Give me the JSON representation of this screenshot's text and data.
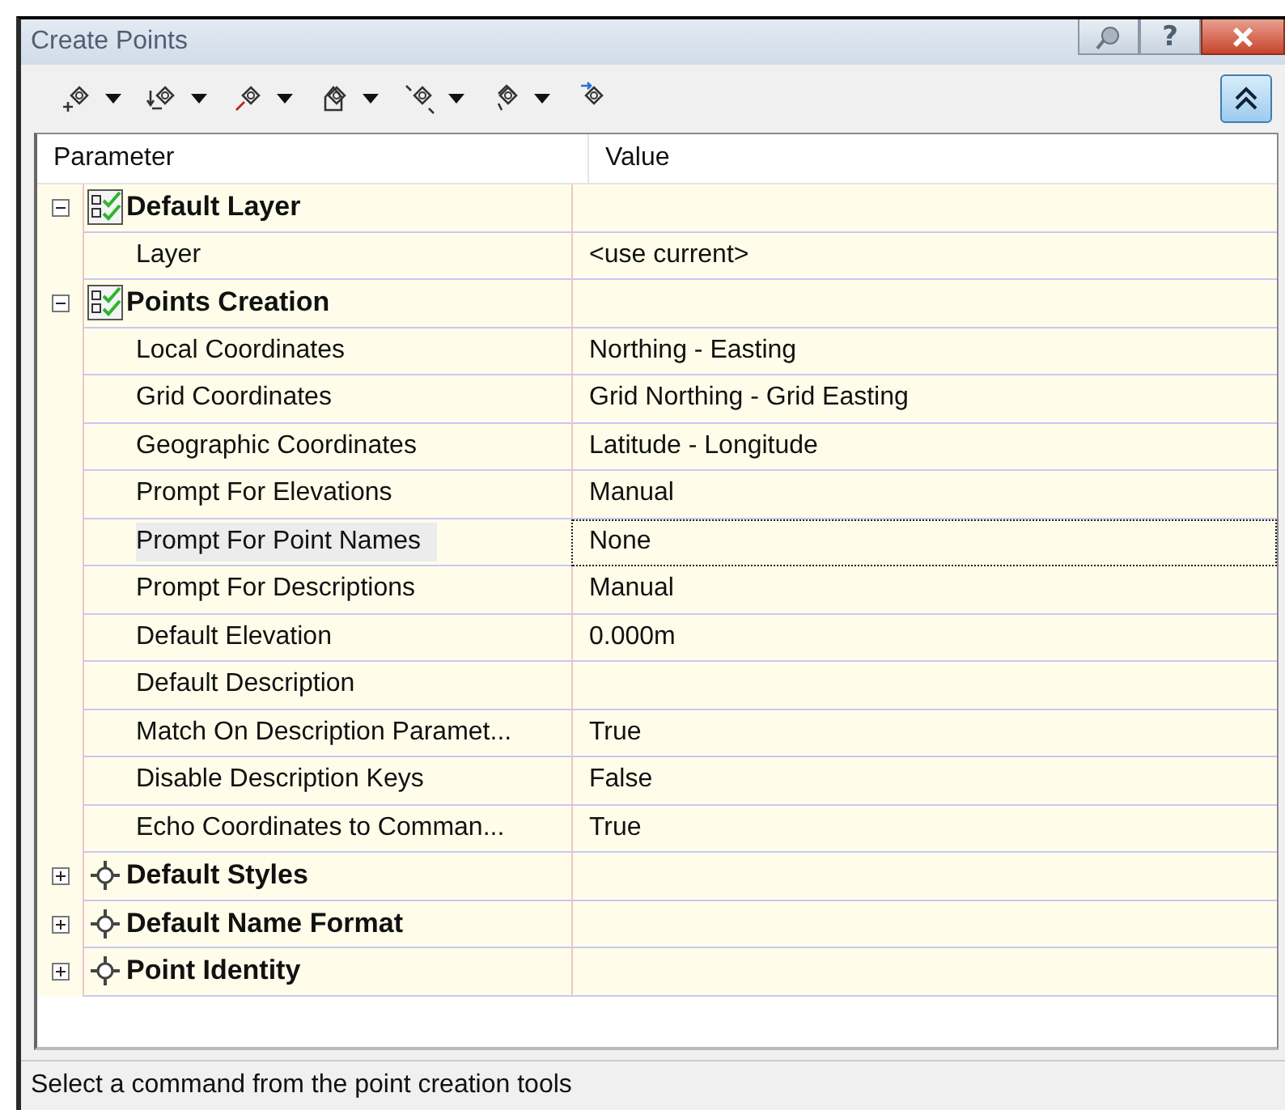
{
  "window": {
    "title": "Create Points",
    "help": "?"
  },
  "toolbar": {
    "tools": [
      {
        "dropdown": true
      },
      {
        "dropdown": true
      },
      {
        "dropdown": true
      },
      {
        "dropdown": true
      },
      {
        "dropdown": true
      },
      {
        "dropdown": true
      },
      {
        "dropdown": false
      }
    ],
    "toggle": {
      "pressed": true
    }
  },
  "grid": {
    "columns": [
      "Parameter",
      "Value"
    ],
    "groups": [
      {
        "name": "Default Layer",
        "kind": "layer",
        "expanded": true,
        "rows": [
          {
            "name": "Layer",
            "value": "<use current>",
            "selected": false
          }
        ]
      },
      {
        "name": "Points Creation",
        "kind": "layer",
        "expanded": true,
        "rows": [
          {
            "name": "Local Coordinates",
            "value": "Northing - Easting",
            "selected": false
          },
          {
            "name": "Grid Coordinates",
            "value": "Grid Northing - Grid Easting",
            "selected": false
          },
          {
            "name": "Geographic Coordinates",
            "value": "Latitude - Longitude",
            "selected": false
          },
          {
            "name": "Prompt For Elevations",
            "value": "Manual",
            "selected": false
          },
          {
            "name": "Prompt For Point Names",
            "value": "None",
            "selected": true
          },
          {
            "name": "Prompt For Descriptions",
            "value": "Manual",
            "selected": false
          },
          {
            "name": "Default Elevation",
            "value": "0.000m",
            "selected": false
          },
          {
            "name": "Default Description",
            "selected": false
          },
          {
            "name": "Match On Description Paramet...",
            "value": "True",
            "selected": false
          },
          {
            "name": "Disable Description Keys",
            "value": "False",
            "selected": false
          },
          {
            "name": "Echo Coordinates to Comman...",
            "value": "True",
            "selected": false
          }
        ]
      },
      {
        "name": "Default Styles",
        "kind": "point",
        "expanded": false
      },
      {
        "name": "Default Name Format",
        "kind": "point",
        "expanded": false
      },
      {
        "name": "Point Identity",
        "kind": "point",
        "expanded": false
      }
    ]
  },
  "status_bar": "Select a command from the point creation tools"
}
